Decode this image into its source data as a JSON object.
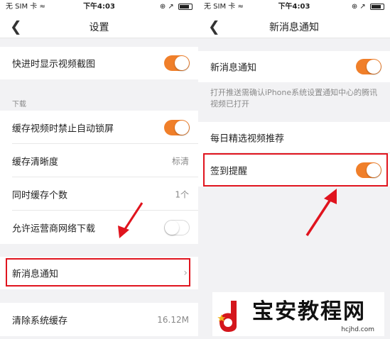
{
  "status": {
    "carrier": "无 SIM 卡",
    "wifi": "≈",
    "time": "下午4:03",
    "indicators": "⊕ ↗"
  },
  "left_screen": {
    "back_icon": "❮",
    "title": "设置",
    "rows": {
      "video_screenshot": {
        "label": "快进时显示视频截图",
        "toggle": "on"
      },
      "download_section": "下载",
      "no_autolock": {
        "label": "缓存视频时禁止自动锁屏",
        "toggle": "on"
      },
      "cache_quality": {
        "label": "缓存清晰度",
        "value": "标清"
      },
      "concurrent": {
        "label": "同时缓存个数",
        "value": "1个"
      },
      "carrier_download": {
        "label": "允许运营商网络下载",
        "toggle": "off"
      },
      "notifications": {
        "label": "新消息通知",
        "chevron": "›"
      },
      "clear_cache": {
        "label": "清除系统缓存",
        "value": "16.12M"
      }
    }
  },
  "right_screen": {
    "back_icon": "❮",
    "title": "新消息通知",
    "rows": {
      "new_message": {
        "label": "新消息通知",
        "toggle": "on"
      },
      "description": "打开推送需确认iPhone系统设置通知中心的腾讯视频已打开",
      "daily_picks": {
        "label": "每日精选视频推荐"
      },
      "checkin_reminder": {
        "label": "签到提醒",
        "toggle": "on"
      }
    }
  },
  "watermark": {
    "title": "宝安教程网",
    "url": "hcjhd.com"
  },
  "colors": {
    "accent": "#f07f2a",
    "highlight": "#e0141e",
    "arrow": "#e0141e"
  }
}
